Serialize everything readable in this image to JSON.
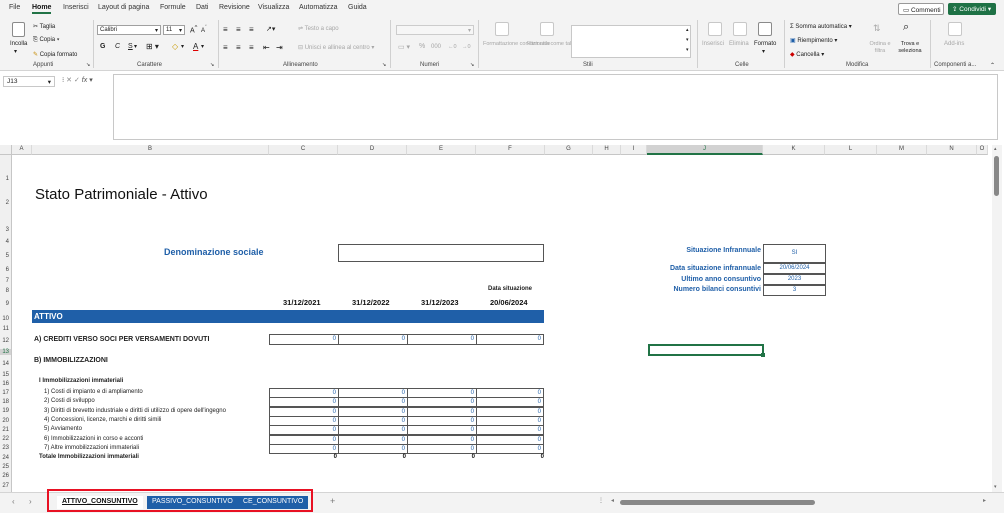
{
  "menu": {
    "tabs": [
      "File",
      "Home",
      "Inserisci",
      "Layout di pagina",
      "Formule",
      "Dati",
      "Revisione",
      "Visualizza",
      "Automatizza",
      "Guida"
    ],
    "active": "Home",
    "comments_label": "Commenti",
    "share_label": "Condividi"
  },
  "ribbon": {
    "clipboard": {
      "paste": "Incolla",
      "cut": "Taglia",
      "copy": "Copia",
      "format_painter": "Copia formato",
      "label": "Appunti"
    },
    "font": {
      "name": "Calibri",
      "size": "11",
      "bold": "G",
      "italic": "C",
      "underline": "S",
      "label": "Carattere"
    },
    "alignment": {
      "wrap": "Testo a capo",
      "merge": "Unisci e allinea al centro",
      "label": "Allineamento"
    },
    "number": {
      "percent": "%",
      "thousands": "000",
      "label": "Numeri"
    },
    "styles": {
      "conditional": "Formattazione condizionale",
      "as_table": "Formatta come tabella",
      "label": "Stili"
    },
    "cells": {
      "insert": "Inserisci",
      "delete": "Elimina",
      "format": "Formato",
      "label": "Celle"
    },
    "editing": {
      "autosum": "Somma automatica",
      "fill": "Riempimento",
      "clear": "Cancella",
      "sort": "Ordina e filtra",
      "find": "Trova e seleziona",
      "label": "Modifica"
    },
    "addins": {
      "button": "Add-ins",
      "label": "Componenti a..."
    }
  },
  "formula_bar": {
    "name_box": "J13",
    "fx": "fx",
    "value": ""
  },
  "columns": [
    {
      "id": "A",
      "w": 20
    },
    {
      "id": "B",
      "w": 237
    },
    {
      "id": "C",
      "w": 69
    },
    {
      "id": "D",
      "w": 69
    },
    {
      "id": "E",
      "w": 69
    },
    {
      "id": "F",
      "w": 69
    },
    {
      "id": "G",
      "w": 48
    },
    {
      "id": "H",
      "w": 28
    },
    {
      "id": "I",
      "w": 26
    },
    {
      "id": "J",
      "w": 116
    },
    {
      "id": "K",
      "w": 62
    },
    {
      "id": "L",
      "w": 52
    },
    {
      "id": "M",
      "w": 50
    },
    {
      "id": "N",
      "w": 50
    },
    {
      "id": "O",
      "w": 11
    }
  ],
  "selected_col": "J",
  "selected_row": "13",
  "rows": [
    "1",
    "2",
    "3",
    "4",
    "5",
    "6",
    "7",
    "8",
    "9",
    "10",
    "11",
    "12",
    "13",
    "14",
    "15",
    "16",
    "17",
    "18",
    "19",
    "20",
    "21",
    "22",
    "23",
    "24",
    "25",
    "26",
    "27"
  ],
  "sheet": {
    "title": "Stato Patrimoniale - Attivo",
    "denominazione": "Denominazione sociale",
    "situation": {
      "infrannuale_label": "Situazione Infrannuale",
      "infrannuale_value": "SI",
      "data_label": "Data situazione infrannuale",
      "data_value": "20/06/2024",
      "ultimo_label": "Ultimo anno consuntivo",
      "ultimo_value": "2023",
      "numero_label": "Numero bilanci consuntivi",
      "numero_value": "3"
    },
    "data_situazione_label": "Data situazione",
    "dates": [
      "31/12/2021",
      "31/12/2022",
      "31/12/2023",
      "20/06/2024"
    ],
    "attivo": "ATTIVO",
    "crediti": {
      "label": "A) CREDITI VERSO SOCI PER VERSAMENTI DOVUTI",
      "values": [
        "0",
        "0",
        "0",
        "0"
      ]
    },
    "immobilizzazioni": "B) IMMOBILIZZAZIONI",
    "immateriali_title": "I Immobilizzazioni immateriali",
    "immateriali": [
      {
        "label": "1) Costi di impianto e di ampliamento",
        "values": [
          "0",
          "0",
          "0",
          "0"
        ]
      },
      {
        "label": "2) Costi di sviluppo",
        "values": [
          "0",
          "0",
          "0",
          "0"
        ]
      },
      {
        "label": "3) Diritti di brevetto industriale e diritti di utilizzo di opere dell'ingegno",
        "values": [
          "0",
          "0",
          "0",
          "0"
        ]
      },
      {
        "label": "4) Concessioni, licenze, marchi e diritti simili",
        "values": [
          "0",
          "0",
          "0",
          "0"
        ]
      },
      {
        "label": "5) Avviamento",
        "values": [
          "0",
          "0",
          "0",
          "0"
        ]
      },
      {
        "label": "6) Immobilizzazioni in corso e acconti",
        "values": [
          "0",
          "0",
          "0",
          "0"
        ]
      },
      {
        "label": "7) Altre immobilizzazioni immateriali",
        "values": [
          "0",
          "0",
          "0",
          "0"
        ]
      }
    ],
    "totale": {
      "label": "Totale Immobilizzazioni immateriali",
      "values": [
        "0",
        "0",
        "0",
        "0"
      ]
    }
  },
  "sheet_tabs": [
    "ATTIVO_CONSUNTIVO",
    "PASSIVO_CONSUNTIVO",
    "CE_CONSUNTIVO"
  ],
  "add_sheet": "+",
  "colors": {
    "accent": "#217346",
    "blue": "#1f5fa8",
    "highlight": "#e81123"
  }
}
